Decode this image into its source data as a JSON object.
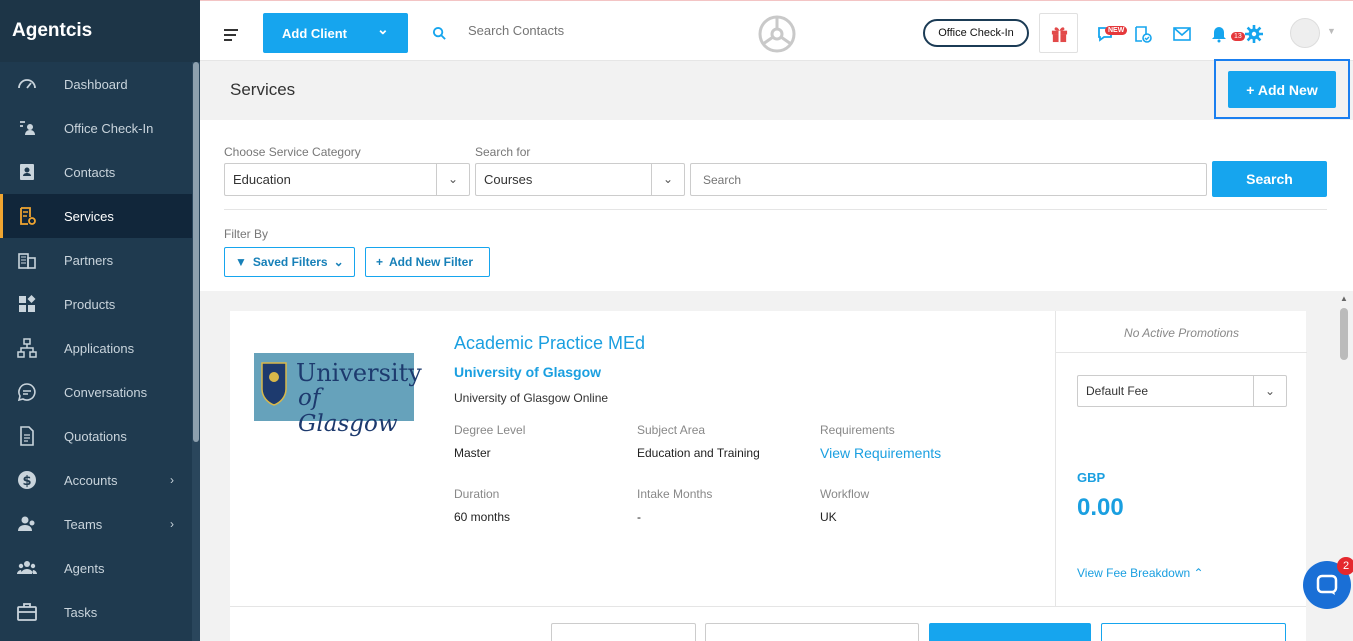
{
  "app": {
    "brand": "Agentcis"
  },
  "sidebar": {
    "items": [
      {
        "label": "Dashboard",
        "icon": "dashboard-icon"
      },
      {
        "label": "Office Check-In",
        "icon": "checkin-icon"
      },
      {
        "label": "Contacts",
        "icon": "contacts-icon"
      },
      {
        "label": "Services",
        "icon": "services-icon",
        "active": true
      },
      {
        "label": "Partners",
        "icon": "partners-icon"
      },
      {
        "label": "Products",
        "icon": "products-icon"
      },
      {
        "label": "Applications",
        "icon": "applications-icon"
      },
      {
        "label": "Conversations",
        "icon": "conversations-icon"
      },
      {
        "label": "Quotations",
        "icon": "quotations-icon"
      },
      {
        "label": "Accounts",
        "icon": "accounts-icon",
        "expandable": true
      },
      {
        "label": "Teams",
        "icon": "teams-icon",
        "expandable": true
      },
      {
        "label": "Agents",
        "icon": "agents-icon"
      },
      {
        "label": "Tasks",
        "icon": "tasks-icon"
      }
    ]
  },
  "topbar": {
    "add_client_label": "Add Client",
    "search_placeholder": "Search Contacts",
    "office_checkin_label": "Office Check-In",
    "new_badge": "NEW",
    "notification_count": "13"
  },
  "header": {
    "title": "Services",
    "add_new_label": "+ Add New"
  },
  "filters": {
    "category_label": "Choose Service Category",
    "category_value": "Education",
    "search_for_label": "Search for",
    "search_for_value": "Courses",
    "search_placeholder": "Search",
    "search_button": "Search",
    "filter_by_label": "Filter By",
    "saved_filters_label": "Saved Filters",
    "add_filter_label": "Add New Filter"
  },
  "result": {
    "course": "Academic Practice MEd",
    "university": "University of Glasgow",
    "campus": "University of Glasgow Online",
    "logo_text_1": "University",
    "logo_text_2": "of Glasgow",
    "degree_level_label": "Degree Level",
    "degree_level": "Master",
    "subject_area_label": "Subject Area",
    "subject_area": "Education and Training",
    "requirements_label": "Requirements",
    "requirements_link": "View Requirements",
    "duration_label": "Duration",
    "duration": "60 months",
    "intake_label": "Intake Months",
    "intake": "-",
    "workflow_label": "Workflow",
    "workflow": "UK",
    "promotions": "No Active Promotions",
    "fee_option": "Default Fee",
    "currency": "GBP",
    "amount": "0.00",
    "fee_breakdown": "View Fee Breakdown"
  },
  "chat": {
    "badge": "2"
  },
  "colors": {
    "accent": "#16a5ee",
    "sidebar": "#1f3a4f",
    "active_marker": "#f0a531",
    "badge": "#e5383b"
  }
}
